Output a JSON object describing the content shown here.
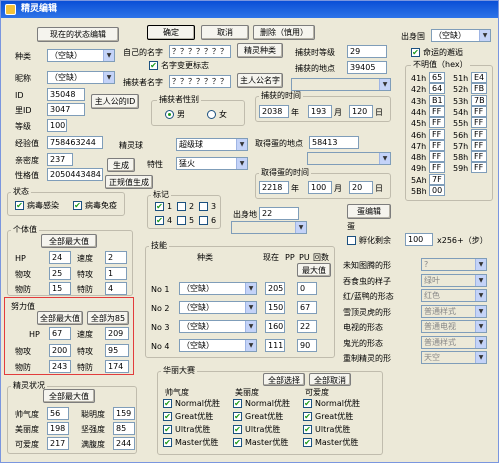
{
  "window": {
    "title": "精灵编辑"
  },
  "top": {
    "load_state": "现在的状态编辑",
    "ok": "确定",
    "cancel": "取消",
    "delete": "删除（慎用）",
    "area_label": "出身国",
    "area_value": "（空缺）"
  },
  "basic": {
    "species_label": "种类",
    "species_value": "（空缺）",
    "nick_label": "昵称",
    "nick_value": "（空缺）",
    "id_label": "ID",
    "id_value": "35048",
    "sid_label": "里ID",
    "sid_value": "3047",
    "master_id": "主人公的ID",
    "level_label": "等级",
    "level_value": "100",
    "exp_label": "经验值",
    "exp_value": "758463244",
    "friend_label": "亲密度",
    "friend_value": "237",
    "personality_label": "性格值",
    "personality_value": "2050443484",
    "generate": "生成",
    "legit_generate": "正规值生成",
    "ball_label": "精灵球",
    "ball_value": "超级球",
    "trait_label": "特性",
    "trait_value": "猛火"
  },
  "names": {
    "own_name_label": "自己的名字",
    "own_name_value": "？？？？？？？",
    "pkmn_kind": "精灵种类",
    "name_changed": "名字变更标志",
    "catcher_label": "捕获者名字",
    "catcher_value": "？？？？？？？",
    "hero_name": "主人公名字",
    "catch_level_label": "捕获时等级",
    "catch_level_value": "29",
    "catch_place_label": "捕获的地点",
    "catch_place_value": "39405",
    "catcher_sex_label": "捕获者性别",
    "male": "男",
    "female": "女",
    "catch_time_label": "捕获的时间",
    "catch_time": {
      "year": "2038",
      "year_unit": "年",
      "month": "193",
      "month_unit": "月",
      "day": "120",
      "day_unit": "日"
    },
    "obtain_place_label": "取得蛋的地点",
    "obtain_place_value": "58413",
    "obtain_time_label": "取得蛋的时间",
    "obtain_time": {
      "year": "2218",
      "year_unit": "年",
      "month": "100",
      "month_unit": "月",
      "day": "20",
      "day_unit": "日"
    }
  },
  "right": {
    "fateful": "命运的邂逅",
    "unknown_label": "不明值（hex）",
    "hex_rows": [
      [
        "41h",
        "65",
        "51h",
        "E4"
      ],
      [
        "42h",
        "64",
        "52h",
        "FB"
      ],
      [
        "43h",
        "B1",
        "53h",
        "7B"
      ],
      [
        "44h",
        "FF",
        "54h",
        "FF"
      ],
      [
        "45h",
        "FF",
        "55h",
        "FF"
      ],
      [
        "46h",
        "FF",
        "56h",
        "FF"
      ],
      [
        "47h",
        "FF",
        "57h",
        "FF"
      ],
      [
        "48h",
        "FF",
        "58h",
        "FF"
      ],
      [
        "49h",
        "FF",
        "59h",
        "FF"
      ],
      [
        "5Ah",
        "7F",
        "",
        ""
      ],
      [
        "5Bh",
        "00",
        "",
        ""
      ]
    ]
  },
  "status": {
    "title": "状态",
    "virus": "病毒感染",
    "immune": "病毒免疫"
  },
  "marks": {
    "title": "标记",
    "items": [
      "1",
      "2",
      "3",
      "4",
      "5",
      "6"
    ]
  },
  "birth": {
    "label": "出身地",
    "value": "22",
    "egg_edit": "蛋编辑",
    "egg": "蛋",
    "hatch": "孵化剩余",
    "hatch_value": "100",
    "hatch_unit": "x256+（步）"
  },
  "iv": {
    "title": "个体值",
    "max_all": "全部最大值",
    "hp_label": "HP",
    "hp": "24",
    "spd_label": "速度",
    "spd": "2",
    "atk_label": "物攻",
    "atk": "25",
    "spatk_label": "特攻",
    "spatk": "1",
    "def_label": "物防",
    "def": "15",
    "spdef_label": "特防",
    "spdef": "4"
  },
  "ev": {
    "title": "努力值",
    "max_all": "全部最大值",
    "all85": "全部为85",
    "hp_label": "HP",
    "hp": "67",
    "spd_label": "速度",
    "spd": "209",
    "atk_label": "物攻",
    "atk": "200",
    "spatk_label": "特攻",
    "spatk": "95",
    "def_label": "物防",
    "def": "243",
    "spdef_label": "特防",
    "spdef": "174"
  },
  "moves": {
    "title": "技能",
    "col_kind": "种类",
    "col_now": "现在",
    "col_pp": "PP",
    "col_pu": "PU",
    "col_up": "回数",
    "col_max": "最大值",
    "rows": [
      {
        "label": "No 1",
        "kind": "（空缺）",
        "now": "205",
        "pu": "0"
      },
      {
        "label": "No 2",
        "kind": "（空缺）",
        "now": "150",
        "pu": "67"
      },
      {
        "label": "No 3",
        "kind": "（空缺）",
        "now": "160",
        "pu": "22"
      },
      {
        "label": "No 4",
        "kind": "（空缺）",
        "now": "111",
        "pu": "90"
      }
    ]
  },
  "forms": {
    "rows": [
      {
        "label": "未知图腾的形",
        "value": "?"
      },
      {
        "label": "吞食虫的样子",
        "value": "绿叶"
      },
      {
        "label": "红/蓝鸭的形态",
        "value": "红色"
      },
      {
        "label": "雪顶灵虎的形",
        "value": "普通样式"
      },
      {
        "label": "电视的形态",
        "value": "普通电视"
      },
      {
        "label": "鬼光的形态",
        "value": "普通样式"
      },
      {
        "label": "重制精灵的形",
        "value": "天空"
      }
    ]
  },
  "condition": {
    "title": "精灵状况",
    "max_all": "全部最大值",
    "rows": [
      {
        "a_label": "帅气度",
        "a": "56",
        "b_label": "聪明度",
        "b": "159"
      },
      {
        "a_label": "美丽度",
        "a": "198",
        "b_label": "坚强度",
        "b": "85"
      },
      {
        "a_label": "可爱度",
        "a": "217",
        "b_label": "满腹度",
        "b": "244"
      }
    ]
  },
  "contest": {
    "title": "华丽大赛",
    "all_select": "全部选择",
    "all_cancel": "全部取消",
    "groups": [
      {
        "title": "帅气度"
      },
      {
        "title": "美丽度"
      },
      {
        "title": "可爱度"
      }
    ],
    "items": [
      "Normal优胜",
      "Great优胜",
      "Ultra优胜",
      "Master优胜"
    ]
  }
}
